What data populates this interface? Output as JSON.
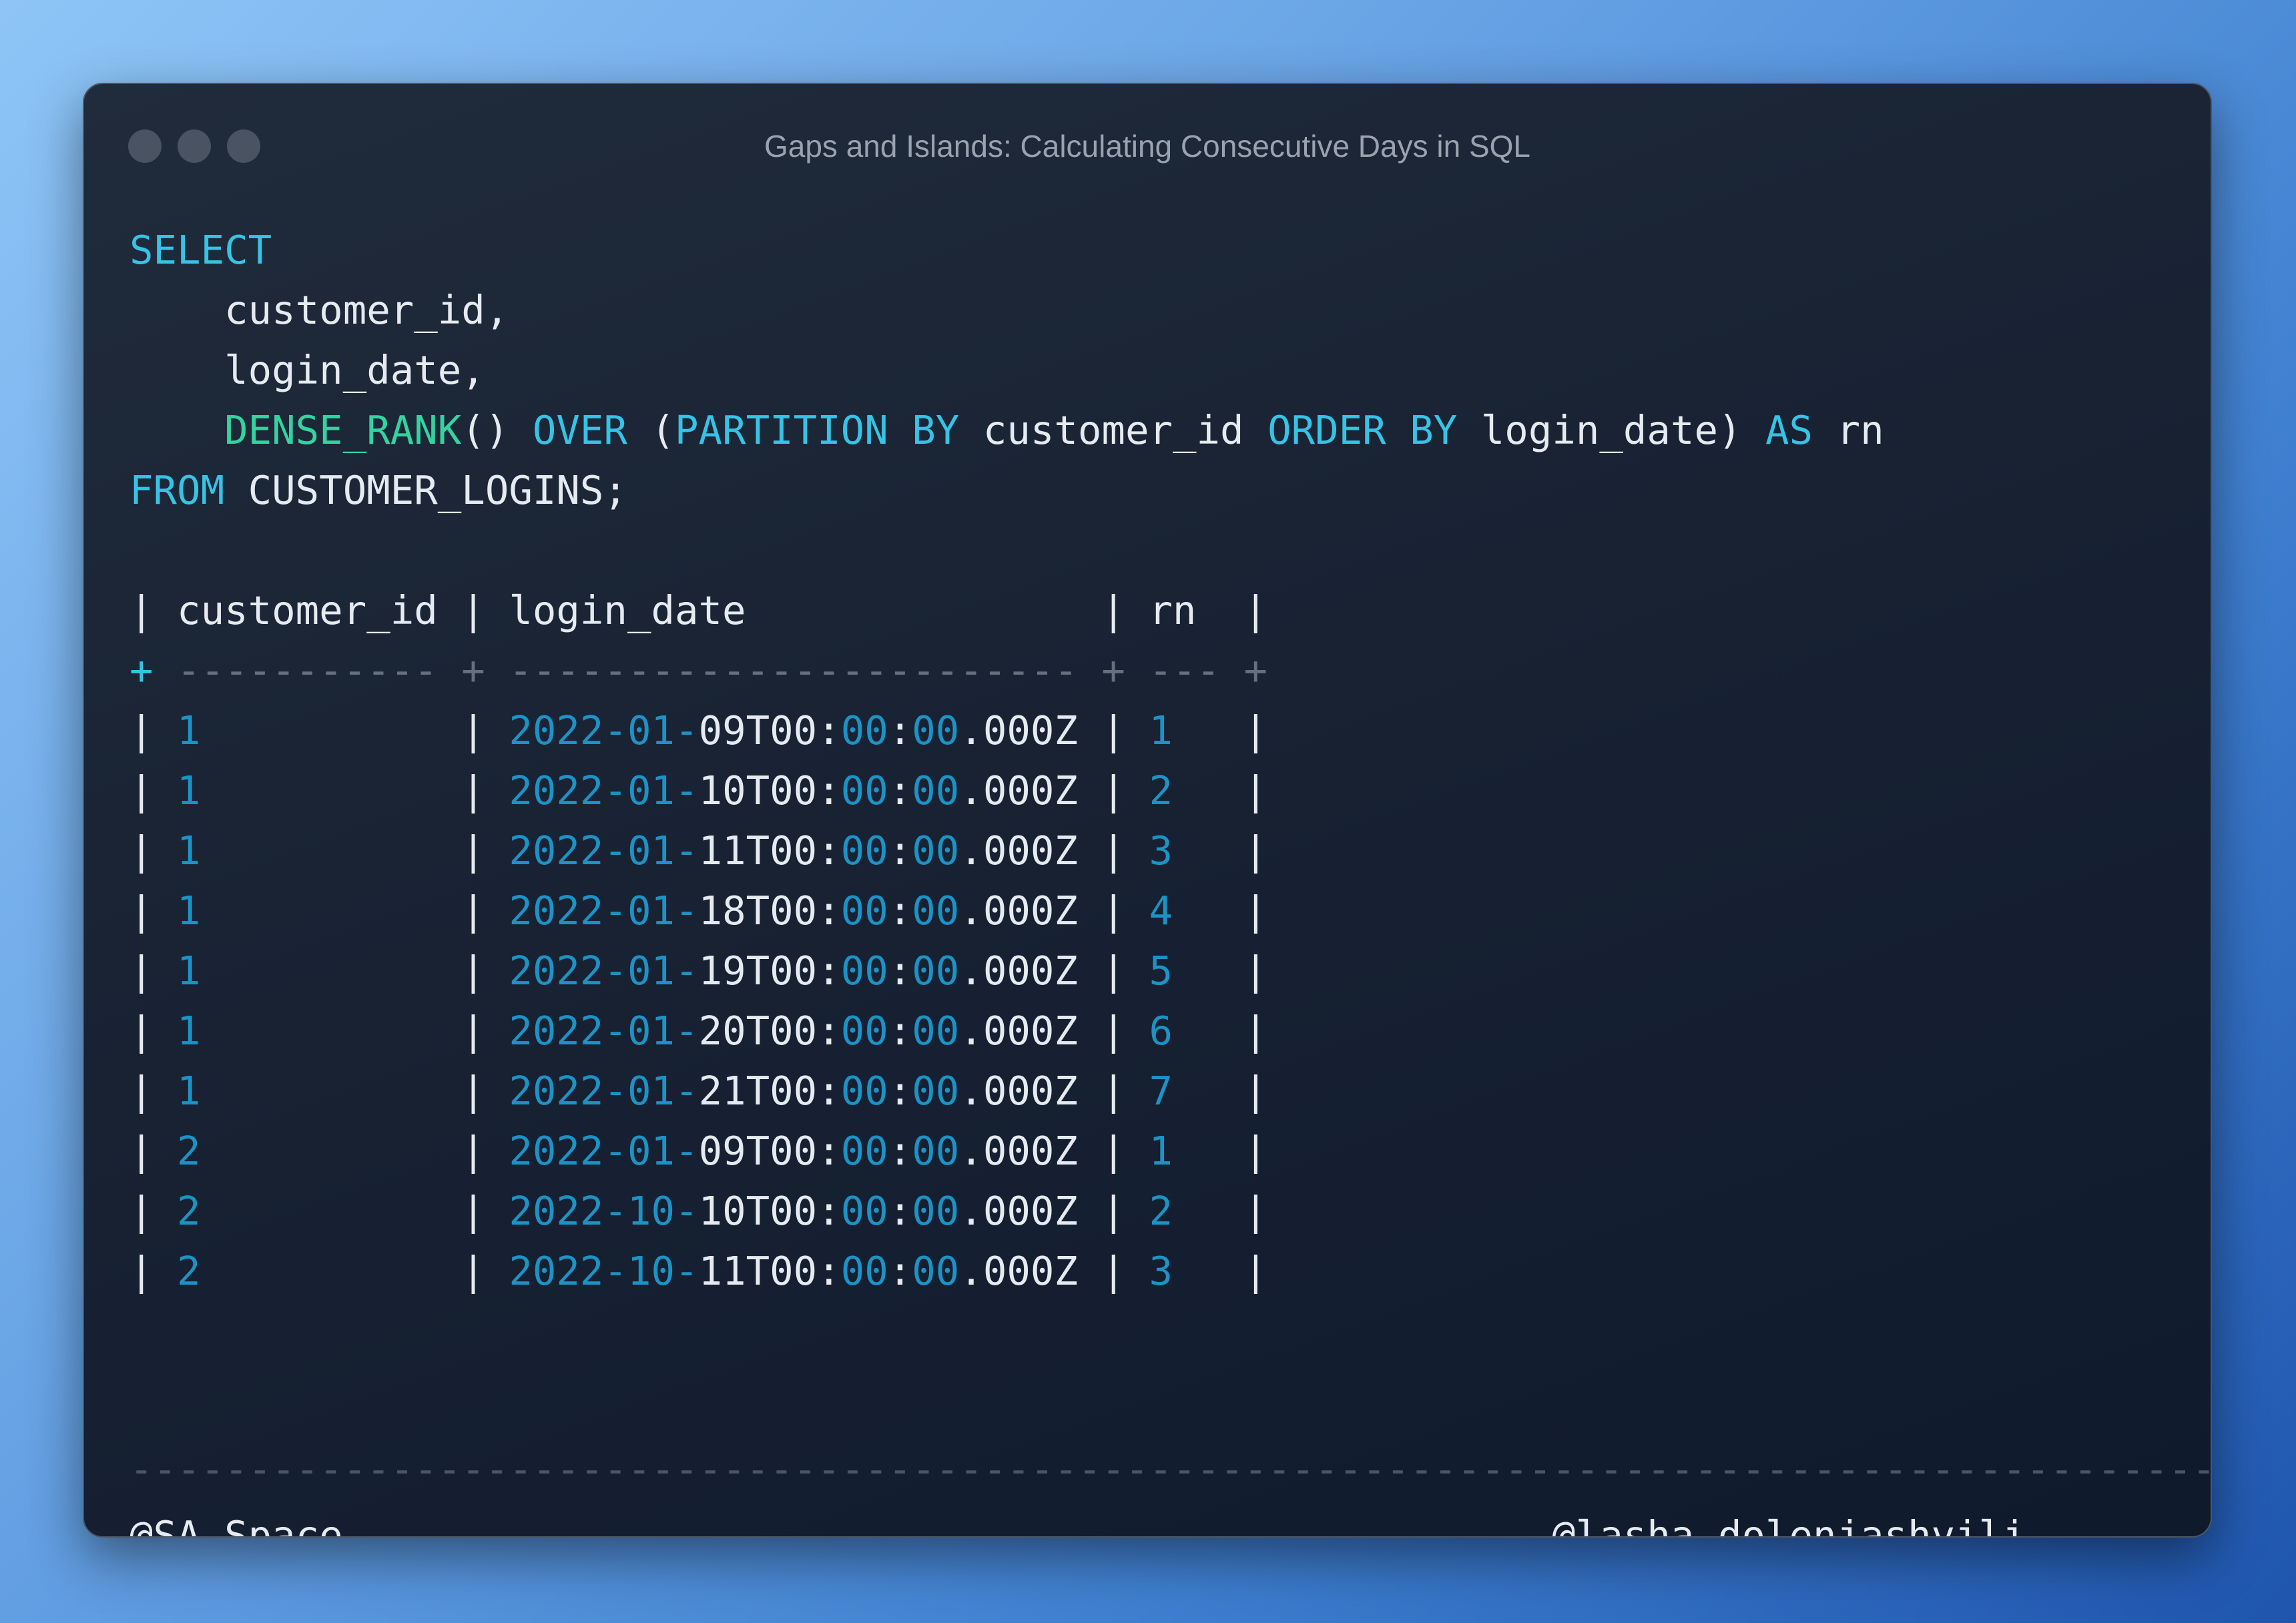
{
  "window": {
    "title": "Gaps and Islands: Calculating Consecutive Days in SQL"
  },
  "query": {
    "lines": [
      [
        {
          "t": "SELECT",
          "c": "kw"
        }
      ],
      [
        {
          "t": "    customer_id,",
          "c": ""
        }
      ],
      [
        {
          "t": "    login_date,",
          "c": ""
        }
      ],
      [
        {
          "t": "    ",
          "c": ""
        },
        {
          "t": "DENSE_RANK",
          "c": "fn"
        },
        {
          "t": "() ",
          "c": ""
        },
        {
          "t": "OVER",
          "c": "kw"
        },
        {
          "t": " (",
          "c": ""
        },
        {
          "t": "PARTITION BY",
          "c": "kw"
        },
        {
          "t": " customer_id ",
          "c": ""
        },
        {
          "t": "ORDER BY",
          "c": "kw"
        },
        {
          "t": " login_date) ",
          "c": ""
        },
        {
          "t": "AS",
          "c": "kw"
        },
        {
          "t": " rn",
          "c": ""
        }
      ],
      [
        {
          "t": "FROM",
          "c": "kw"
        },
        {
          "t": " CUSTOMER_LOGINS;",
          "c": ""
        }
      ]
    ]
  },
  "result": {
    "header_line": "| customer_id | login_date               | rn  |",
    "separator_line": [
      {
        "t": "+",
        "c": "plus"
      },
      {
        "t": " ----------- + ------------------------ + --- +",
        "c": "sep"
      }
    ],
    "rows": [
      {
        "customer_id": "1",
        "date": "2022",
        "month": "01",
        "day_time": "09T00",
        "minute": "00",
        "second": "00",
        "ms": ".000Z",
        "rn": "1"
      },
      {
        "customer_id": "1",
        "date": "2022",
        "month": "01",
        "day_time": "10T00",
        "minute": "00",
        "second": "00",
        "ms": ".000Z",
        "rn": "2"
      },
      {
        "customer_id": "1",
        "date": "2022",
        "month": "01",
        "day_time": "11T00",
        "minute": "00",
        "second": "00",
        "ms": ".000Z",
        "rn": "3"
      },
      {
        "customer_id": "1",
        "date": "2022",
        "month": "01",
        "day_time": "18T00",
        "minute": "00",
        "second": "00",
        "ms": ".000Z",
        "rn": "4"
      },
      {
        "customer_id": "1",
        "date": "2022",
        "month": "01",
        "day_time": "19T00",
        "minute": "00",
        "second": "00",
        "ms": ".000Z",
        "rn": "5"
      },
      {
        "customer_id": "1",
        "date": "2022",
        "month": "01",
        "day_time": "20T00",
        "minute": "00",
        "second": "00",
        "ms": ".000Z",
        "rn": "6"
      },
      {
        "customer_id": "1",
        "date": "2022",
        "month": "01",
        "day_time": "21T00",
        "minute": "00",
        "second": "00",
        "ms": ".000Z",
        "rn": "7"
      },
      {
        "customer_id": "2",
        "date": "2022",
        "month": "01",
        "day_time": "09T00",
        "minute": "00",
        "second": "00",
        "ms": ".000Z",
        "rn": "1"
      },
      {
        "customer_id": "2",
        "date": "2022",
        "month": "10",
        "day_time": "10T00",
        "minute": "00",
        "second": "00",
        "ms": ".000Z",
        "rn": "2"
      },
      {
        "customer_id": "2",
        "date": "2022",
        "month": "10",
        "day_time": "11T00",
        "minute": "00",
        "second": "00",
        "ms": ".000Z",
        "rn": "3"
      }
    ]
  },
  "footer": {
    "rule": "--------------------------------------------------------------------------------------------------------------------",
    "left_handle": "@SA Space",
    "middle_dashes": " - - - - - - - - - - - - - - - - - - - - - - - - - ",
    "right_handle_part1": "@lasha",
    "right_handle_hyphen": "-",
    "right_handle_part2": "dolenjashvili"
  }
}
